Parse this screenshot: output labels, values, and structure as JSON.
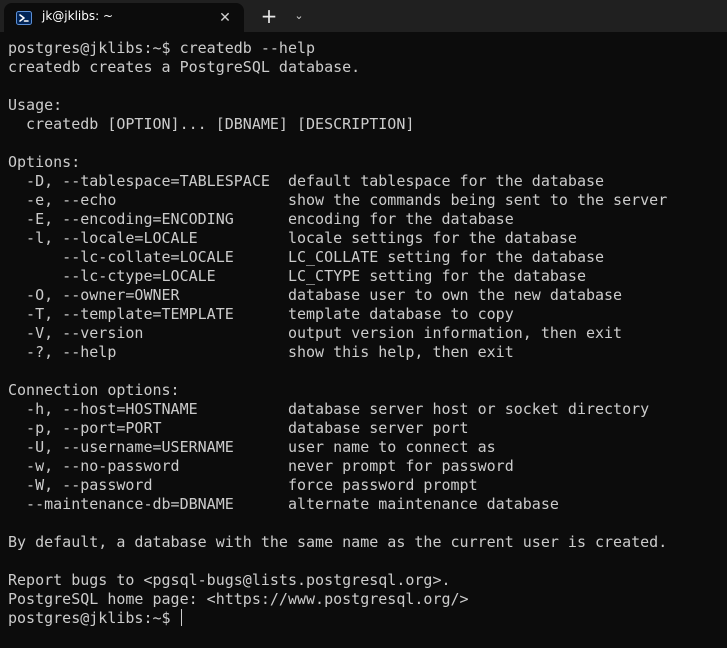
{
  "tab": {
    "title": "jk@jklibs: ~",
    "icon": "terminal-icon",
    "close_label": "✕"
  },
  "titlebar": {
    "new_tab_label": "+",
    "dropdown_label": "⌄"
  },
  "colors": {
    "background": "#0c0c0c",
    "foreground": "#cccccc",
    "titlebar": "#202020"
  },
  "terminal": {
    "lines": [
      "postgres@jklibs:~$ createdb --help",
      "createdb creates a PostgreSQL database.",
      "",
      "Usage:",
      "  createdb [OPTION]... [DBNAME] [DESCRIPTION]",
      "",
      "Options:",
      "  -D, --tablespace=TABLESPACE  default tablespace for the database",
      "  -e, --echo                   show the commands being sent to the server",
      "  -E, --encoding=ENCODING      encoding for the database",
      "  -l, --locale=LOCALE          locale settings for the database",
      "      --lc-collate=LOCALE      LC_COLLATE setting for the database",
      "      --lc-ctype=LOCALE        LC_CTYPE setting for the database",
      "  -O, --owner=OWNER            database user to own the new database",
      "  -T, --template=TEMPLATE      template database to copy",
      "  -V, --version                output version information, then exit",
      "  -?, --help                   show this help, then exit",
      "",
      "Connection options:",
      "  -h, --host=HOSTNAME          database server host or socket directory",
      "  -p, --port=PORT              database server port",
      "  -U, --username=USERNAME      user name to connect as",
      "  -w, --no-password            never prompt for password",
      "  -W, --password               force password prompt",
      "  --maintenance-db=DBNAME      alternate maintenance database",
      "",
      "By default, a database with the same name as the current user is created.",
      "",
      "Report bugs to <pgsql-bugs@lists.postgresql.org>.",
      "PostgreSQL home page: <https://www.postgresql.org/>"
    ],
    "prompt": "postgres@jklibs:~$ "
  }
}
